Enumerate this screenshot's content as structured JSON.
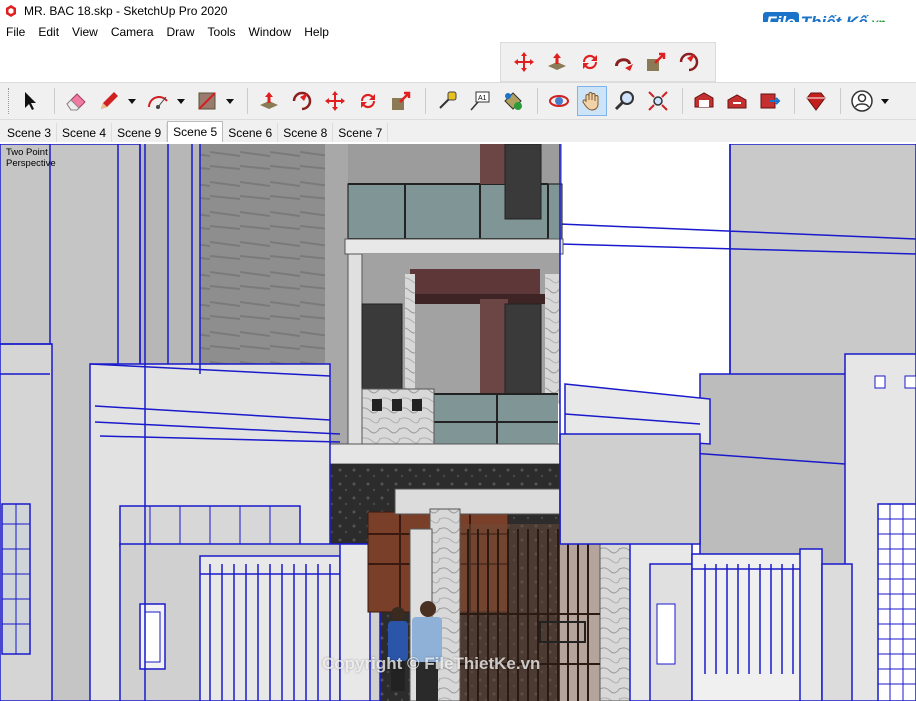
{
  "window": {
    "title": "MR. BAC 18.skp - SketchUp Pro 2020"
  },
  "brand": {
    "box": "File",
    "rest": "Thiết Kế",
    "suffix": ".vn"
  },
  "menu": [
    "File",
    "Edit",
    "View",
    "Camera",
    "Draw",
    "Tools",
    "Window",
    "Help"
  ],
  "toolbar_top": [
    {
      "name": "move-icon",
      "color": "#e02020"
    },
    {
      "name": "pushpull-icon",
      "color": "#e02020"
    },
    {
      "name": "rotate-icon",
      "color": "#e02020"
    },
    {
      "name": "followme-icon",
      "color": "#e02020"
    },
    {
      "name": "scale-icon",
      "color": "#e02020"
    },
    {
      "name": "offset-icon",
      "color": "#e02020"
    }
  ],
  "scenes": [
    "Scene 3",
    "Scene 4",
    "Scene 9",
    "Scene 5",
    "Scene 6",
    "Scene 8",
    "Scene 7"
  ],
  "active_scene": "Scene 5",
  "viewport": {
    "perspective_line1": "Two Point",
    "perspective_line2": "Perspective"
  },
  "watermark": "Copyright © FileThietKe.vn",
  "colors": {
    "edge_blue": "#1a1acc",
    "accent_red": "#e02020"
  }
}
